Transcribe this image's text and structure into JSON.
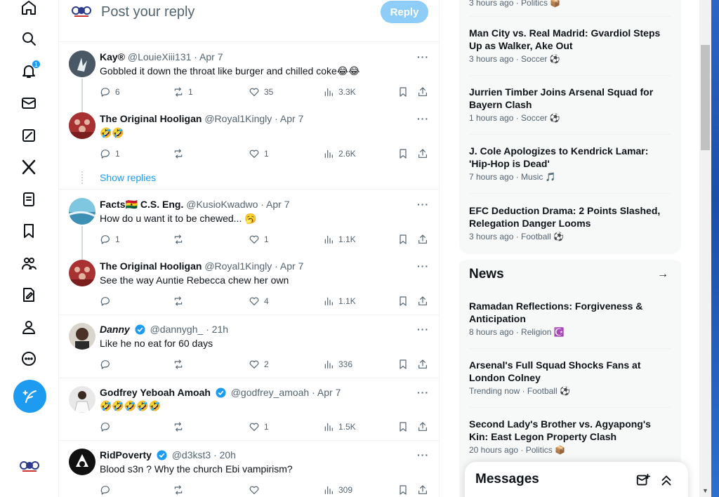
{
  "leftnav": {
    "icons": [
      "home-icon",
      "explore-icon",
      "notifications-icon",
      "messages-icon",
      "grok-icon",
      "x-premium-icon",
      "lists-icon",
      "bookmarks-icon",
      "communities-icon",
      "verified-orgs-icon",
      "profile-icon",
      "more-icon"
    ],
    "notification_count": "1",
    "post_icon": "feather-plus-icon"
  },
  "reply_bar": {
    "placeholder": "Post your reply",
    "button": "Reply"
  },
  "tweets": [
    {
      "name": "Kay®",
      "handle": "@LouieXiii131",
      "time": "· Apr 7",
      "text": "Gobbled it down the throat like burger and chilled coke😂😂",
      "replies": "6",
      "reposts": "1",
      "likes": "35",
      "views": "3.3K"
    },
    {
      "name": "The Original Hooligan",
      "handle": "@Royal1Kingly",
      "time": "· Apr 7",
      "text": "🤣🤣",
      "replies": "1",
      "reposts": "",
      "likes": "1",
      "views": "2.6K"
    },
    {
      "name": "Facts🇬🇭 C.S. Eng.",
      "handle": "@KusioKwadwo",
      "time": "· Apr 7",
      "text": "How do u want it to be chewed... 🥱",
      "replies": "1",
      "reposts": "",
      "likes": "1",
      "views": "1.1K"
    },
    {
      "name": "The Original Hooligan",
      "handle": "@Royal1Kingly",
      "time": "· Apr 7",
      "text": "See the way Auntie Rebecca chew her own",
      "replies": "",
      "reposts": "",
      "likes": "4",
      "views": "1.1K"
    },
    {
      "name": "Danny",
      "handle": "@dannygh_",
      "time": "· 21h",
      "text": "Like he no eat for 60 days",
      "replies": "",
      "reposts": "",
      "likes": "2",
      "views": "336"
    },
    {
      "name": "Godfrey Yeboah Amoah",
      "handle": "@godfrey_amoah",
      "time": "· Apr 7",
      "text": "🤣🤣🤣🤣🤣",
      "replies": "",
      "reposts": "",
      "likes": "1",
      "views": "1.5K"
    },
    {
      "name": "RidPoverty",
      "handle": "@d3kst3",
      "time": "· 20h",
      "text": "Blood s3n ? Why the church Ebi vampirism?",
      "replies": "",
      "reposts": "",
      "likes": "",
      "views": "309"
    }
  ],
  "show_replies": "Show replies",
  "trends_top_meta": "3 hours ago · Politics 📦",
  "trends": [
    {
      "title": "Man City vs. Real Madrid: Gvardiol Steps Up as Walker, Ake Out",
      "meta": "3 hours ago · Soccer ⚽"
    },
    {
      "title": "Jurrien Timber Joins Arsenal Squad for Bayern Clash",
      "meta": "1 hours ago · Soccer ⚽"
    },
    {
      "title": "J. Cole Apologizes to Kendrick Lamar: 'Hip-Hop is Dead'",
      "meta": "7 hours ago · Music 🎵"
    },
    {
      "title": "EFC Deduction Drama: 2 Points Slashed, Relegation Danger Looms",
      "meta": "3 hours ago · Football ⚽"
    }
  ],
  "news": {
    "heading": "News",
    "items": [
      {
        "title": "Ramadan Reflections: Forgiveness & Anticipation",
        "meta": "8 hours ago · Religion ☪️"
      },
      {
        "title": "Arsenal's Full Squad Shocks Fans at London Colney",
        "meta": "Trending now · Football ⚽"
      },
      {
        "title": "Second Lady's Brother vs. Agyapong's Kin: East Legon Property Clash",
        "meta": "20 hours ago · Politics 📦"
      }
    ]
  },
  "messages": {
    "title": "Messages"
  }
}
